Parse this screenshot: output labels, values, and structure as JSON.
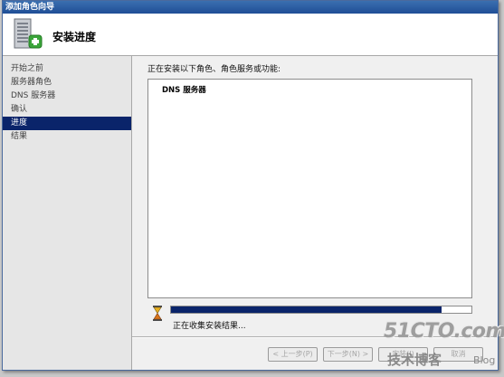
{
  "window": {
    "title": "添加角色向导"
  },
  "header": {
    "title": "安装进度",
    "icon": "server-add-role-icon"
  },
  "sidebar": {
    "items": [
      {
        "label": "开始之前",
        "active": false
      },
      {
        "label": "服务器角色",
        "active": false
      },
      {
        "label": "DNS 服务器",
        "active": false
      },
      {
        "label": "确认",
        "active": false
      },
      {
        "label": "进度",
        "active": true
      },
      {
        "label": "结果",
        "active": false
      }
    ]
  },
  "main": {
    "instruction": "正在安装以下角色、角色服务或功能:",
    "installing_items": [
      "DNS 服务器"
    ],
    "progress_fraction": 0.9,
    "status_text": "正在收集安装结果...",
    "status_icon": "hourglass-icon"
  },
  "buttons": {
    "previous": "< 上一步(P)",
    "next": "下一步(N) >",
    "install": "安装(I)",
    "cancel": "取消"
  },
  "watermark": {
    "main": "51CTO.com",
    "sub": "技术博客",
    "blog": "Blog"
  },
  "colors": {
    "selection": "#0a246a",
    "titlebar": "#1f4e96",
    "progress": "#0a246a"
  }
}
